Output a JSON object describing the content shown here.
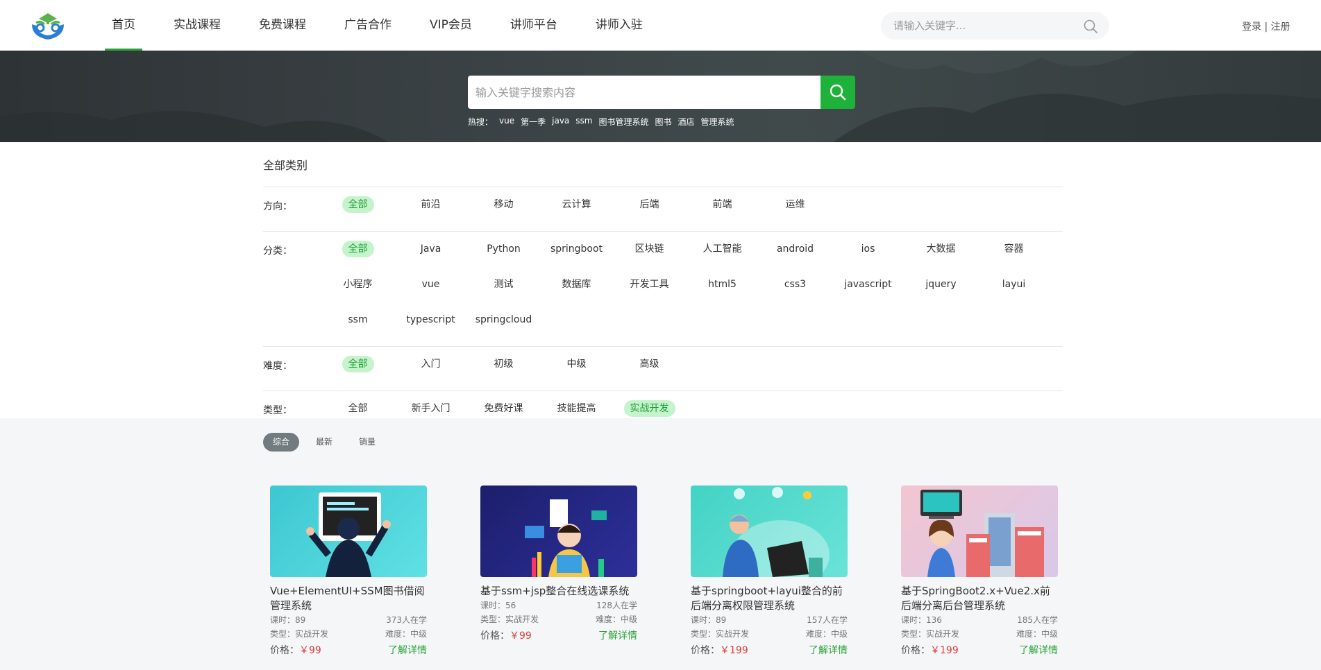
{
  "header": {
    "nav": [
      "首页",
      "实战课程",
      "免费课程",
      "广告合作",
      "VIP会员",
      "讲师平台",
      "讲师入驻"
    ],
    "active_nav": "首页",
    "search_placeholder": "请输入关键字...",
    "login": "登录",
    "separator": "|",
    "register": "注册"
  },
  "banner": {
    "search_placeholder": "输入关键字搜索内容",
    "hot_label": "热搜：",
    "hot_keywords": [
      "vue",
      "第一季",
      "java",
      "ssm",
      "图书管理系统",
      "图书",
      "酒店",
      "管理系统"
    ]
  },
  "filters": {
    "title": "全部类别",
    "rows": [
      {
        "label": "方向：",
        "items": [
          "全部",
          "前沿",
          "移动",
          "云计算",
          "后端",
          "前端",
          "运维"
        ],
        "active": "全部"
      },
      {
        "label": "分类：",
        "items": [
          "全部",
          "Java",
          "Python",
          "springboot",
          "区块链",
          "人工智能",
          "android",
          "ios",
          "大数据",
          "容器",
          "小程序",
          "vue",
          "测试",
          "数据库",
          "开发工具",
          "html5",
          "css3",
          "javascript",
          "jquery",
          "layui",
          "ssm",
          "typescript",
          "springcloud"
        ],
        "active": "全部"
      },
      {
        "label": "难度：",
        "items": [
          "全部",
          "入门",
          "初级",
          "中级",
          "高级"
        ],
        "active": "全部"
      },
      {
        "label": "类型：",
        "items": [
          "全部",
          "新手入门",
          "免费好课",
          "技能提高",
          "实战开发"
        ],
        "active": "实战开发"
      }
    ]
  },
  "sort": {
    "options": [
      "综合",
      "最新",
      "销量"
    ],
    "active": "综合"
  },
  "courses": [
    {
      "title": "Vue+ElementUI+SSM图书借阅管理系统",
      "hours": "课时：89",
      "learners": "373人在学",
      "type": "类型：实战开发",
      "level": "难度：中级",
      "price_label": "价格：",
      "price": "￥99",
      "detail": "了解详情",
      "thumb_colors": [
        "#3ec7d1",
        "#5fe0e4"
      ]
    },
    {
      "title": "基于ssm+jsp整合在线选课系统",
      "hours": "课时：56",
      "learners": "128人在学",
      "type": "类型：实战开发",
      "level": "难度：中级",
      "price_label": "价格：",
      "price": "￥99",
      "detail": "了解详情",
      "thumb_colors": [
        "#1c1f6b",
        "#2d2f9a"
      ]
    },
    {
      "title": "基于springboot+layui整合的前后端分离权限管理系统",
      "hours": "课时：89",
      "learners": "157人在学",
      "type": "类型：实战开发",
      "level": "难度：中级",
      "price_label": "价格：",
      "price": "￥199",
      "detail": "了解详情",
      "thumb_colors": [
        "#43d3c5",
        "#6ae3d8"
      ]
    },
    {
      "title": "基于SpringBoot2.x+Vue2.x前后端分离后台管理系统",
      "hours": "课时：136",
      "learners": "185人在学",
      "type": "类型：实战开发",
      "level": "难度：中级",
      "price_label": "价格：",
      "price": "￥199",
      "detail": "了解详情",
      "thumb_colors": [
        "#f3c5d0",
        "#d8c9e8"
      ]
    }
  ]
}
